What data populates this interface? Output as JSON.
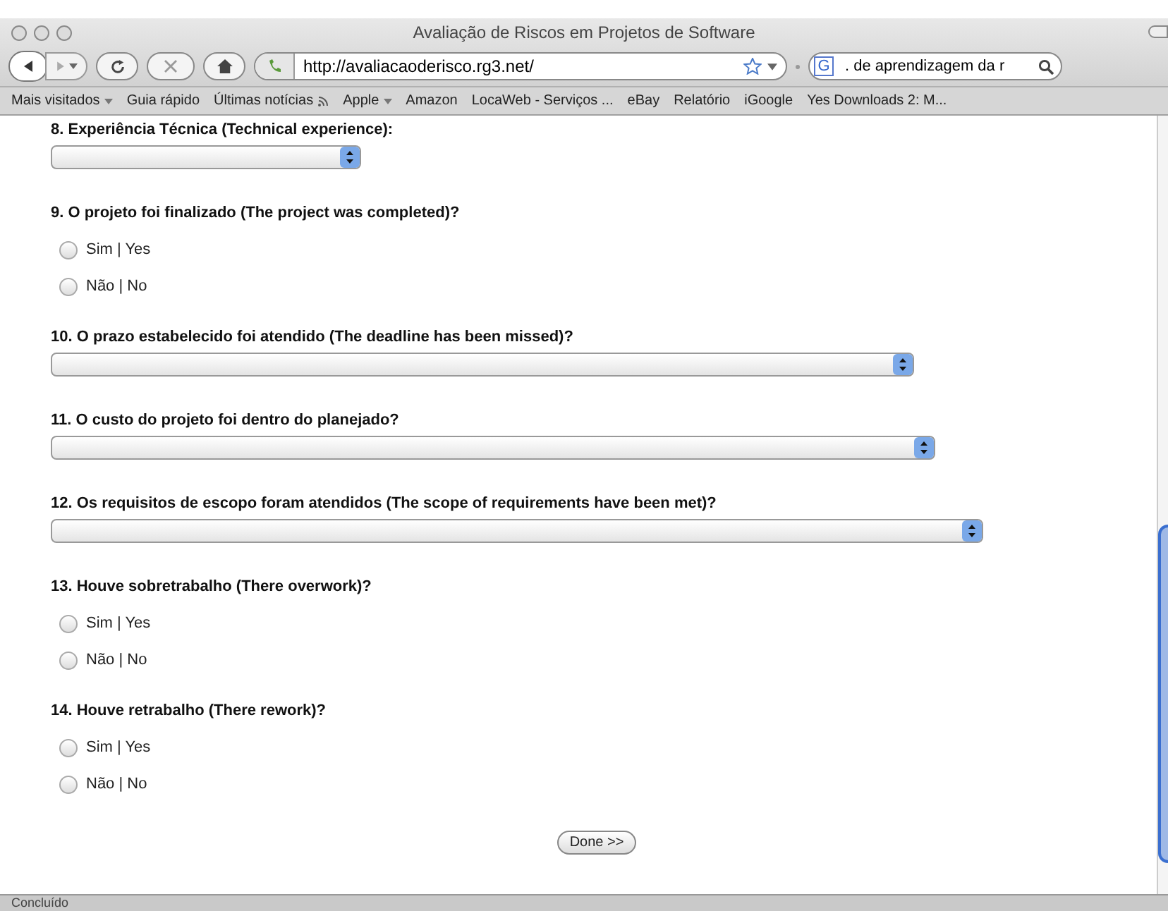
{
  "window": {
    "title": "Avaliação de Riscos em Projetos de Software"
  },
  "toolbar": {
    "url": "http://avaliacaoderisco.rg3.net/",
    "search_engine": "G",
    "search": ". de aprendizagem da r"
  },
  "bookmarks": [
    {
      "label": "Mais visitados",
      "kind": "menu"
    },
    {
      "label": "Guia rápido",
      "kind": "link"
    },
    {
      "label": "Últimas notícias",
      "kind": "feed"
    },
    {
      "label": "Apple",
      "kind": "menu"
    },
    {
      "label": "Amazon",
      "kind": "link"
    },
    {
      "label": "LocaWeb - Serviços ...",
      "kind": "link"
    },
    {
      "label": "eBay",
      "kind": "link"
    },
    {
      "label": "Relatório",
      "kind": "link"
    },
    {
      "label": "iGoogle",
      "kind": "link"
    },
    {
      "label": "Yes Downloads 2: M...",
      "kind": "link"
    }
  ],
  "questions": [
    {
      "label": "8. Experiência Técnica (Technical experience):",
      "kind": "select"
    },
    {
      "label": "9. O projeto foi finalizado (The project was completed)?",
      "kind": "radio",
      "options": [
        {
          "label": "Sim | Yes",
          "selected": false
        },
        {
          "label": "Não | No",
          "selected": false
        }
      ]
    },
    {
      "label": "10. O prazo estabelecido foi atendido (The deadline has been missed)?",
      "kind": "select"
    },
    {
      "label": "11. O custo do projeto foi dentro do planejado?",
      "kind": "select"
    },
    {
      "label": "12. Os requisitos de escopo foram atendidos (The scope of requirements have been met)?",
      "kind": "select"
    },
    {
      "label": "13. Houve sobretrabalho (There overwork)?",
      "kind": "radio",
      "options": [
        {
          "label": "Sim | Yes",
          "selected": false
        },
        {
          "label": "Não | No",
          "selected": false
        }
      ]
    },
    {
      "label": "14. Houve retrabalho (There rework)?",
      "kind": "radio",
      "options": [
        {
          "label": "Sim | Yes",
          "selected": false
        },
        {
          "label": "Não | No",
          "selected": false
        }
      ]
    }
  ],
  "submit": "Done >>",
  "status_bar": "Concluído"
}
